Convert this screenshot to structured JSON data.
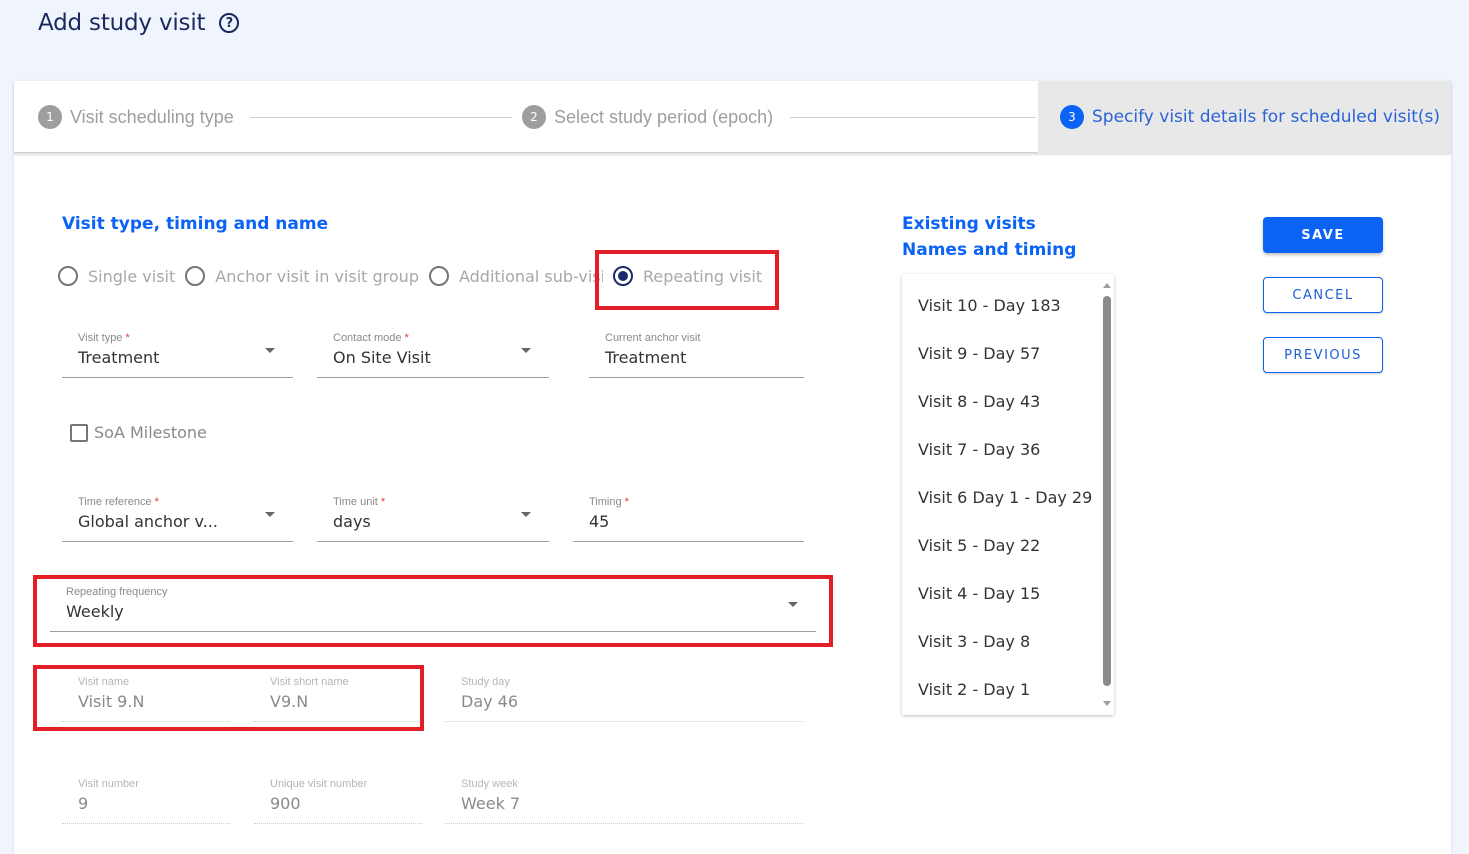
{
  "header": {
    "title": "Add study visit",
    "help_icon": "help-circle-icon"
  },
  "stepper": {
    "steps": [
      {
        "number": "1",
        "label": "Visit scheduling type",
        "active": false
      },
      {
        "number": "2",
        "label": "Select study period (epoch)",
        "active": false
      },
      {
        "number": "3",
        "label": "Specify visit details for scheduled visit(s)",
        "active": true
      }
    ]
  },
  "form": {
    "section_title": "Visit type, timing and name",
    "visit_class_options": [
      {
        "label": "Single visit",
        "checked": false
      },
      {
        "label": "Anchor visit in visit group",
        "checked": false
      },
      {
        "label": "Additional sub-visit",
        "checked": false
      },
      {
        "label": "Repeating visit",
        "checked": true
      }
    ],
    "visit_type": {
      "label": "Visit type",
      "required": "*",
      "value": "Treatment"
    },
    "contact_mode": {
      "label": "Contact mode",
      "required": "*",
      "value": "On Site Visit"
    },
    "current_anchor_visit": {
      "label": "Current anchor visit",
      "value": "Treatment"
    },
    "soa_milestone": {
      "label": "SoA Milestone",
      "checked": false
    },
    "time_reference": {
      "label": "Time reference",
      "required": "*",
      "value": "Global anchor v..."
    },
    "time_unit": {
      "label": "Time unit",
      "required": "*",
      "value": "days"
    },
    "timing": {
      "label": "Timing",
      "required": "*",
      "value": "45"
    },
    "repeating_frequency": {
      "label": "Repeating frequency",
      "value": "Weekly"
    },
    "visit_name": {
      "label": "Visit name",
      "value": "Visit 9.N"
    },
    "visit_short_name": {
      "label": "Visit short name",
      "value": "V9.N"
    },
    "study_day": {
      "label": "Study day",
      "value": "Day 46"
    },
    "visit_number": {
      "label": "Visit number",
      "value": "9"
    },
    "unique_visit_number": {
      "label": "Unique visit number",
      "value": "900"
    },
    "study_week": {
      "label": "Study week",
      "value": "Week 7"
    }
  },
  "existing_visits": {
    "title_line1": "Existing visits",
    "title_line2": "Names and timing",
    "items": [
      "Visit 10 - Day 183",
      "Visit 9 - Day 57",
      "Visit 8 - Day 43",
      "Visit 7 - Day 36",
      "Visit 6 Day 1 - Day 29",
      "Visit 5 - Day 22",
      "Visit 4 - Day 15",
      "Visit 3 - Day 8",
      "Visit 2 - Day 1"
    ]
  },
  "actions": {
    "save_label": "SAVE",
    "cancel_label": "CANCEL",
    "previous_label": "PREVIOUS"
  },
  "colors": {
    "accent": "#0b63f6",
    "highlight": "#e41e26",
    "title": "#1a2a5e",
    "required": "#e53935"
  }
}
